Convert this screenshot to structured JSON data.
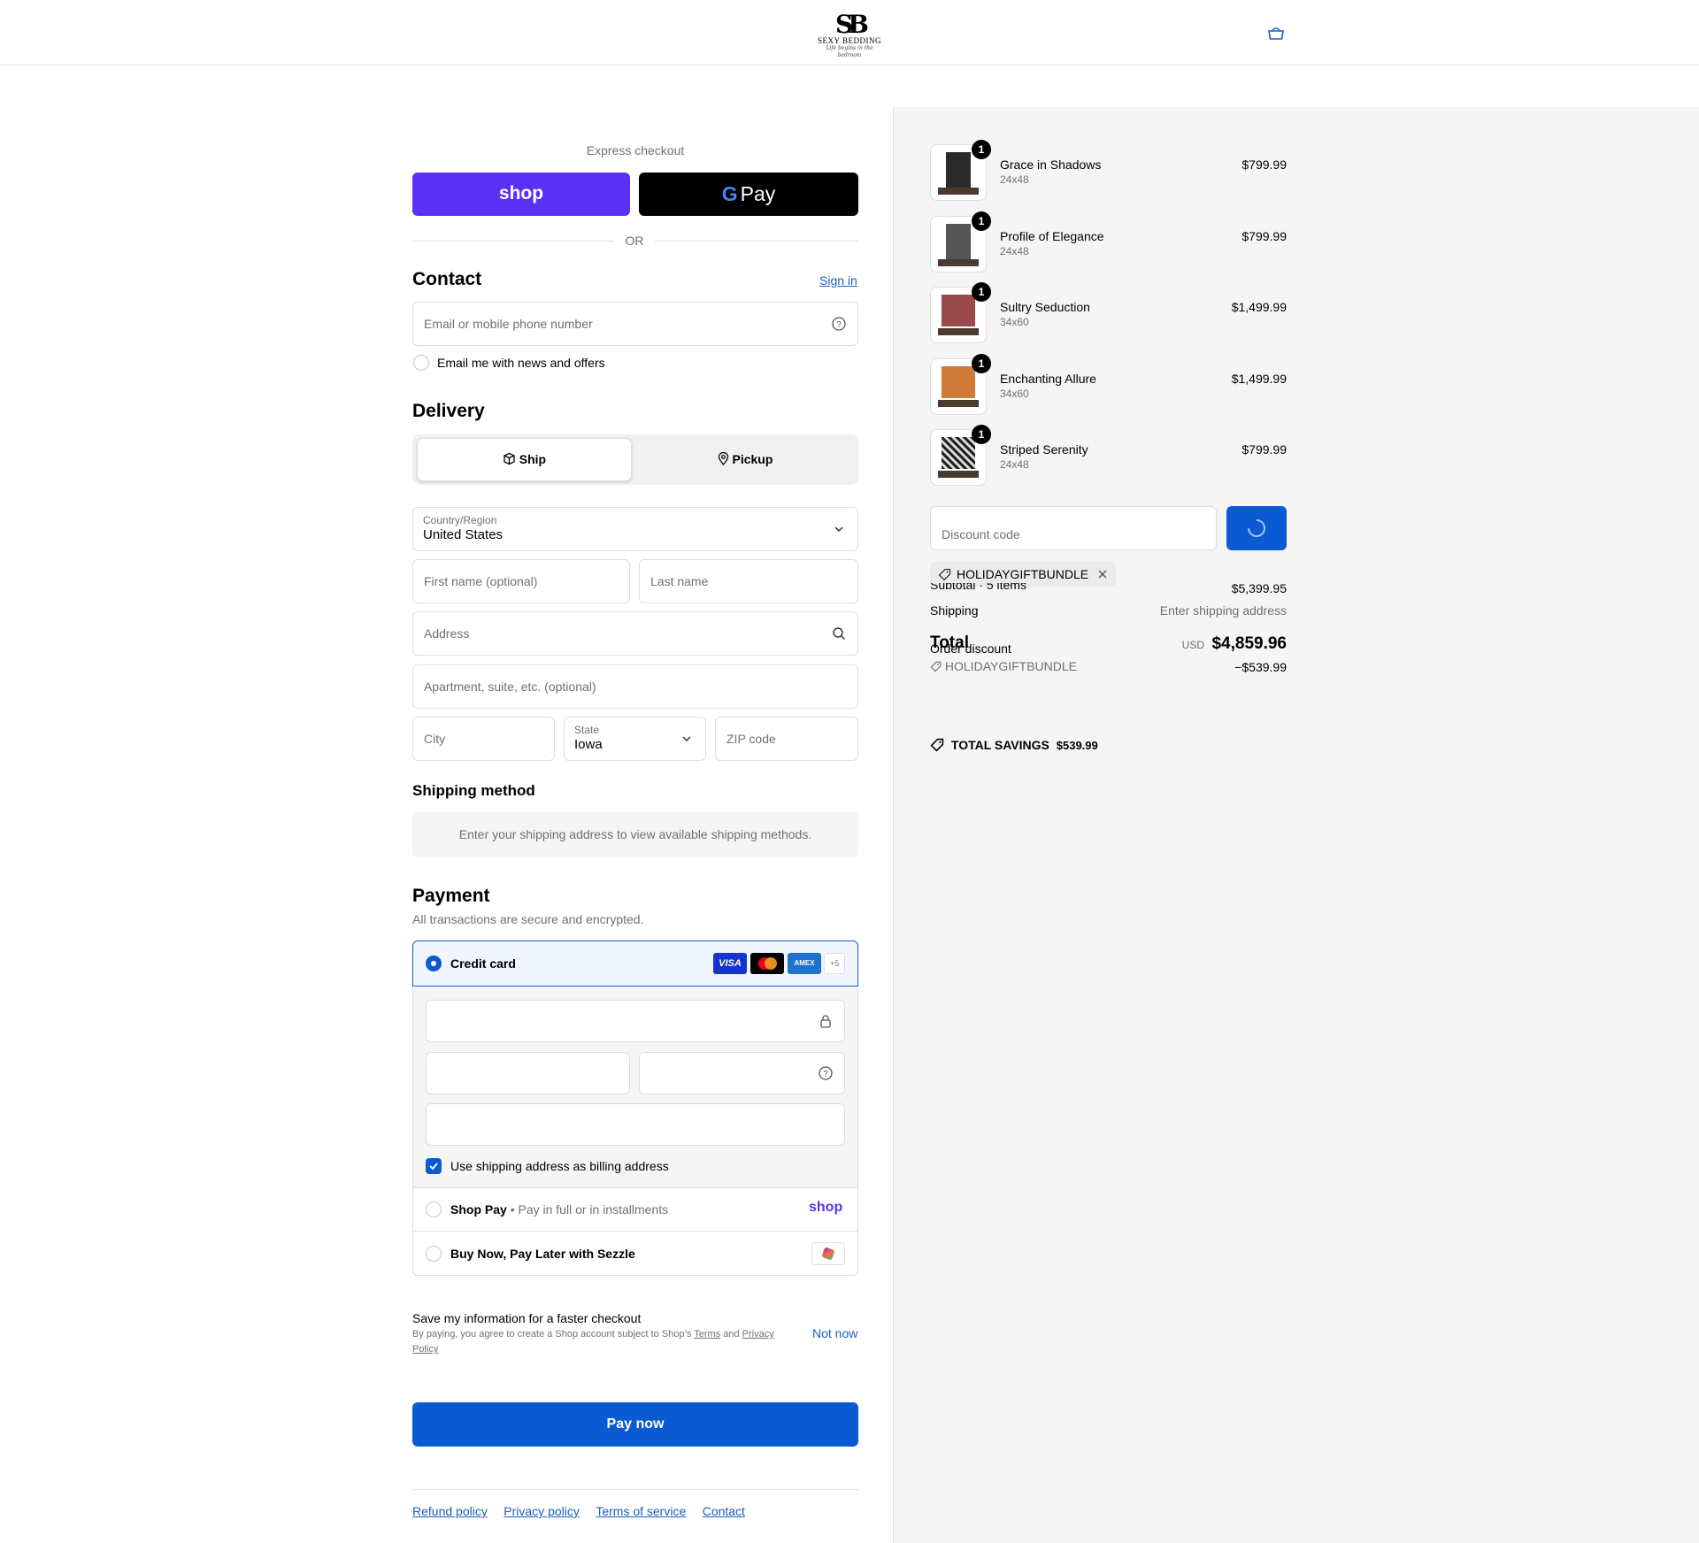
{
  "header": {
    "logo_monogram": "SB",
    "logo_name": "SEXY BEDDING",
    "logo_tagline": "Life begins in the bedroom",
    "cart_icon": "shopping-bag-icon"
  },
  "express": {
    "label": "Express checkout",
    "shop_pay_label": "shop",
    "gpay_g": "G",
    "gpay_label": "Pay",
    "or": "OR"
  },
  "contact": {
    "title": "Contact",
    "sign_in": "Sign in",
    "email_placeholder": "Email or mobile phone number",
    "news_label": "Email me with news and offers"
  },
  "delivery": {
    "title": "Delivery",
    "ship": "Ship",
    "pickup": "Pickup",
    "country_label": "Country/Region",
    "country_value": "United States",
    "first_name": "First name (optional)",
    "last_name": "Last name",
    "address": "Address",
    "apartment": "Apartment, suite, etc. (optional)",
    "city": "City",
    "state_label": "State",
    "state_value": "Iowa",
    "zip": "ZIP code"
  },
  "shipping_method": {
    "title": "Shipping method",
    "message": "Enter your shipping address to view available shipping methods."
  },
  "payment": {
    "title": "Payment",
    "subtitle": "All transactions are secure and encrypted.",
    "credit_card": "Credit card",
    "card_visa": "VISA",
    "card_amex": "AMEX",
    "card_more": "+5",
    "billing_same": "Use shipping address as billing address",
    "shop_pay": "Shop Pay",
    "shop_pay_desc": "Pay in full or in installments",
    "shop_pay_logo": "shop",
    "sezzle": "Buy Now, Pay Later with Sezzle"
  },
  "save_info": {
    "title": "Save my information for a faster checkout",
    "legal_prefix": "By paying, you agree to create a Shop account subject to Shop’s",
    "terms": "Terms",
    "and": "and",
    "privacy": "Privacy Policy",
    "not_now": "Not now"
  },
  "pay_now": "Pay now",
  "footer": {
    "refund": "Refund policy",
    "privacy": "Privacy policy",
    "terms": "Terms of service",
    "contact": "Contact"
  },
  "cart": {
    "items": [
      {
        "name": "Grace in Shadows",
        "variant": "24x48",
        "qty": "1",
        "price": "$799.99"
      },
      {
        "name": "Profile of Elegance",
        "variant": "24x48",
        "qty": "1",
        "price": "$799.99"
      },
      {
        "name": "Sultry Seduction",
        "variant": "34x60",
        "qty": "1",
        "price": "$1,499.99"
      },
      {
        "name": "Enchanting Allure",
        "variant": "34x60",
        "qty": "1",
        "price": "$1,499.99"
      },
      {
        "name": "Striped Serenity",
        "variant": "24x48",
        "qty": "1",
        "price": "$799.99"
      }
    ],
    "discount_placeholder": "Discount code",
    "applied_code": "HOLIDAYGIFTBUNDLE",
    "subtotal_label": "Subtotal · 5 items",
    "subtotal_value": "$5,399.95",
    "shipping_label": "Shipping",
    "shipping_value": "Enter shipping address",
    "total_label": "Total",
    "currency": "USD",
    "total_value": "$4,859.96",
    "order_discount_label": "Order discount",
    "order_discount_code": "HOLIDAYGIFTBUNDLE",
    "order_discount_value": "−$539.99",
    "savings_label": "TOTAL SAVINGS",
    "savings_value": "$539.99"
  },
  "colors": {
    "accent": "#0a5bd1",
    "shop_purple": "#5a31f4",
    "gray_bg": "#f5f5f5"
  }
}
